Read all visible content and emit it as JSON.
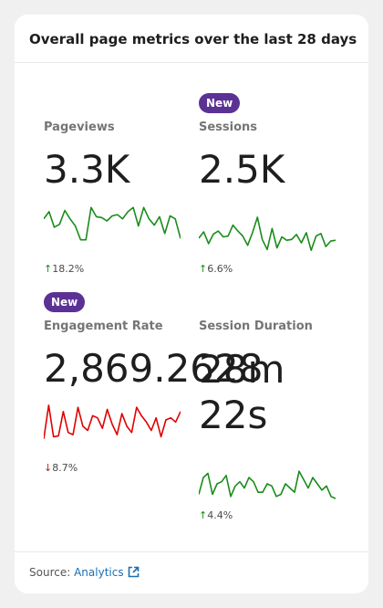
{
  "title": "Overall page metrics over the last 28 days",
  "colors": {
    "up": "#1a8c1a",
    "down": "#e00000",
    "badge": "#5b3294",
    "link": "#1a6fb5"
  },
  "metrics": [
    {
      "label": "Pageviews",
      "value": "3.3K",
      "badge": "",
      "change": "18.2%",
      "direction": "up",
      "spark": [
        0.55,
        0.72,
        0.35,
        0.42,
        0.75,
        0.55,
        0.38,
        0.05,
        0.05,
        0.82,
        0.6,
        0.58,
        0.5,
        0.62,
        0.65,
        0.55,
        0.72,
        0.82,
        0.38,
        0.82,
        0.55,
        0.4,
        0.6,
        0.2,
        0.62,
        0.55,
        0.08
      ]
    },
    {
      "label": "Sessions",
      "value": "2.5K",
      "badge": "New",
      "change": "6.6%",
      "direction": "up",
      "spark": [
        0.35,
        0.5,
        0.22,
        0.45,
        0.52,
        0.38,
        0.4,
        0.66,
        0.52,
        0.4,
        0.18,
        0.48,
        0.85,
        0.32,
        0.08,
        0.58,
        0.12,
        0.38,
        0.3,
        0.32,
        0.44,
        0.24,
        0.48,
        0.06,
        0.4,
        0.46,
        0.15,
        0.28,
        0.3
      ]
    },
    {
      "label": "Engagement Rate",
      "value": "2,869.2628",
      "badge": "New",
      "change": "8.7%",
      "direction": "down",
      "spark": [
        0.05,
        0.85,
        0.1,
        0.12,
        0.7,
        0.2,
        0.15,
        0.8,
        0.35,
        0.25,
        0.6,
        0.55,
        0.3,
        0.75,
        0.4,
        0.15,
        0.65,
        0.35,
        0.2,
        0.8,
        0.6,
        0.45,
        0.25,
        0.55,
        0.1,
        0.5,
        0.55,
        0.45,
        0.7
      ]
    },
    {
      "label": "Session Duration",
      "value": "28m 22s",
      "badge": "",
      "change": "4.4%",
      "direction": "up",
      "spark": [
        0.25,
        0.65,
        0.75,
        0.25,
        0.5,
        0.55,
        0.7,
        0.2,
        0.45,
        0.55,
        0.4,
        0.65,
        0.55,
        0.3,
        0.3,
        0.5,
        0.45,
        0.2,
        0.25,
        0.5,
        0.4,
        0.3,
        0.8,
        0.6,
        0.4,
        0.65,
        0.5,
        0.35,
        0.45,
        0.2,
        0.15
      ]
    }
  ],
  "footer": {
    "source_label": "Source:",
    "source_link": "Analytics"
  }
}
